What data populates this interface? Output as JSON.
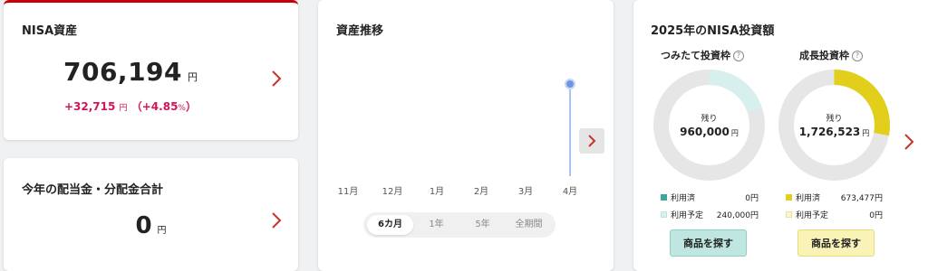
{
  "nisa_assets": {
    "title": "NISA資産",
    "amount": "706,194",
    "unit": "円",
    "gain_amount": "+32,715",
    "gain_unit": "円",
    "gain_pct_open": "（+4.85",
    "gain_pct_unit": "%",
    "gain_pct_close": "）"
  },
  "dividends": {
    "title": "今年の配当金・分配金合計",
    "amount": "0",
    "unit": "円"
  },
  "asset_trend": {
    "title": "資産推移",
    "months": [
      "11月",
      "12月",
      "1月",
      "2月",
      "3月",
      "4月"
    ],
    "periods": [
      "6カ月",
      "1年",
      "5年",
      "全期間"
    ],
    "active_period": "6カ月"
  },
  "nisa_investment": {
    "title": "2025年のNISA投資額",
    "tsumitate": {
      "label": "つみたて投資枠",
      "help_icon": "?",
      "remaining_label": "残り",
      "remaining_value": "960,000",
      "remaining_unit": "円",
      "used_label": "利用済",
      "used_value": "0円",
      "planned_label": "利用予定",
      "planned_value": "240,000円",
      "button": "商品を探す",
      "used_fraction": 0,
      "planned_fraction": 0.2,
      "colors": {
        "used": "#3aa89a",
        "planned": "#d7efed",
        "remaining": "#e6e6e6",
        "button_bg": "#bfe6e0",
        "button_border": "#8ed0c6"
      }
    },
    "growth": {
      "label": "成長投資枠",
      "help_icon": "?",
      "remaining_label": "残り",
      "remaining_value": "1,726,523",
      "remaining_unit": "円",
      "used_label": "利用済",
      "used_value": "673,477円",
      "planned_label": "利用予定",
      "planned_value": "0円",
      "button": "商品を探す",
      "used_fraction": 0.2806,
      "planned_fraction": 0,
      "colors": {
        "used": "#e2cf1c",
        "planned": "#fbf5d0",
        "remaining": "#e6e6e6",
        "button_bg": "#faf3b8",
        "button_border": "#e8dc7a"
      }
    }
  }
}
